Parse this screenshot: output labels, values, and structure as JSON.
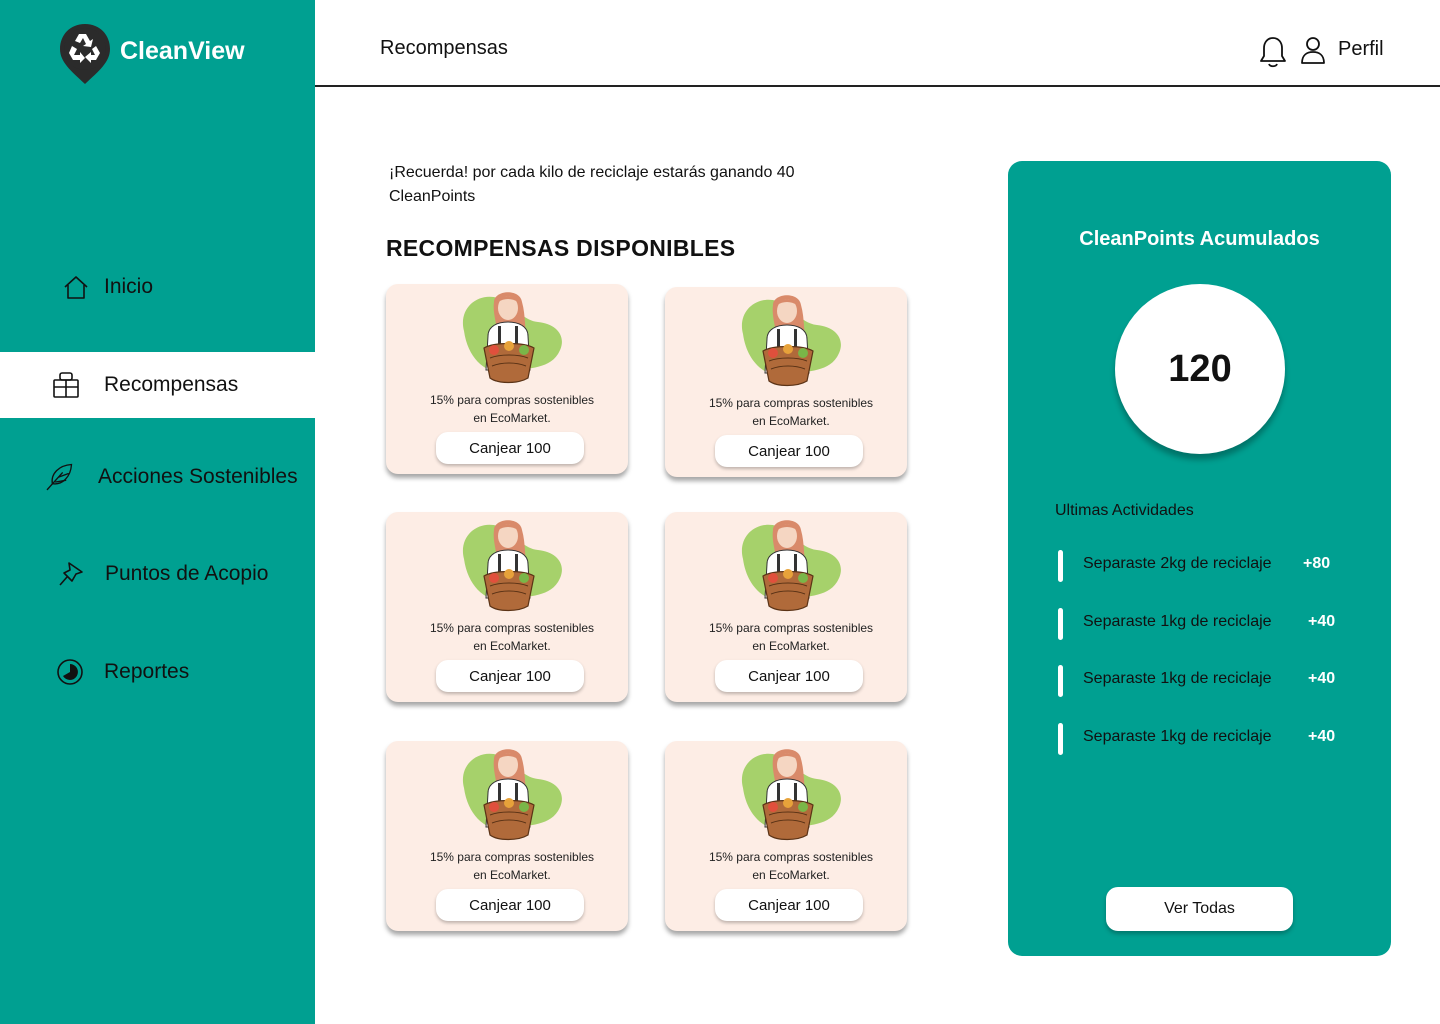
{
  "app": {
    "name": "CleanView"
  },
  "sidebar": {
    "items": [
      {
        "label": "Inicio",
        "icon": "home-icon"
      },
      {
        "label": "Recompensas",
        "icon": "gift-icon",
        "active": true
      },
      {
        "label": "Acciones Sostenibles",
        "icon": "feather-icon"
      },
      {
        "label": "Puntos de Acopio",
        "icon": "pin-icon"
      },
      {
        "label": "Reportes",
        "icon": "pie-chart-icon"
      }
    ]
  },
  "header": {
    "title": "Recompensas",
    "profile_label": "Perfil"
  },
  "main": {
    "reminder": "¡Recuerda! por cada kilo de reciclaje estarás ganando 40 CleanPoints",
    "section_title": "RECOMPENSAS DISPONIBLES",
    "rewards": [
      {
        "line1": "15% para compras sostenibles",
        "line2": "en EcoMarket.",
        "button": "Canjear 100"
      },
      {
        "line1": "15% para compras sostenibles",
        "line2": "en EcoMarket.",
        "button": "Canjear 100"
      },
      {
        "line1": "15% para compras sostenibles",
        "line2": "en EcoMarket.",
        "button": "Canjear 100"
      },
      {
        "line1": "15% para compras sostenibles",
        "line2": "en EcoMarket.",
        "button": "Canjear 100"
      },
      {
        "line1": "15% para compras sostenibles",
        "line2": "en EcoMarket.",
        "button": "Canjear 100"
      },
      {
        "line1": "15% para compras sostenibles",
        "line2": "en EcoMarket.",
        "button": "Canjear 100"
      }
    ]
  },
  "panel": {
    "title": "CleanPoints Acumulados",
    "points": "120",
    "activities_title": "Ultimas Actividades",
    "activities": [
      {
        "text": "Separaste 2kg de reciclaje",
        "points": "+80"
      },
      {
        "text": "Separaste 1kg de reciclaje",
        "points": "+40"
      },
      {
        "text": "Separaste 1kg de reciclaje",
        "points": "+40"
      },
      {
        "text": "Separaste 1kg de reciclaje",
        "points": "+40"
      }
    ],
    "view_all": "Ver Todas"
  },
  "colors": {
    "primary": "#00a091",
    "card_bg": "#fdede5",
    "blob": "#a6d16b"
  }
}
